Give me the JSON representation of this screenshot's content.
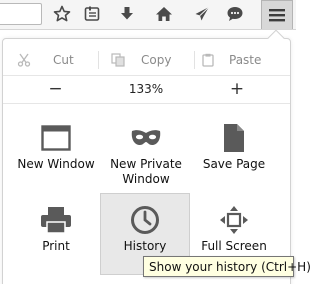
{
  "toolbar": {
    "buttons": [
      {
        "name": "bookmark-star-icon"
      },
      {
        "name": "bookmarks-list-icon"
      },
      {
        "name": "download-icon"
      },
      {
        "name": "home-icon"
      },
      {
        "name": "send-icon"
      },
      {
        "name": "chat-icon"
      },
      {
        "name": "hamburger-menu-icon"
      }
    ]
  },
  "menu": {
    "edit": {
      "cut_label": "Cut",
      "copy_label": "Copy",
      "paste_label": "Paste"
    },
    "zoom": {
      "zoom_out_label": "−",
      "level": "133%",
      "zoom_in_label": "+"
    },
    "grid": [
      {
        "label": "New Window",
        "icon": "window-icon"
      },
      {
        "label": "New Private Window",
        "icon": "mask-icon"
      },
      {
        "label": "Save Page",
        "icon": "page-icon"
      },
      {
        "label": "Print",
        "icon": "printer-icon"
      },
      {
        "label": "History",
        "icon": "clock-icon"
      },
      {
        "label": "Full Screen",
        "icon": "fullscreen-icon"
      }
    ]
  },
  "tooltip": {
    "text": "Show your history (Ctrl+H)"
  },
  "colors": {
    "icon_gray": "#5a5a5a",
    "active_bg": "#e8e8e8",
    "tooltip_bg": "#ffffe1"
  }
}
